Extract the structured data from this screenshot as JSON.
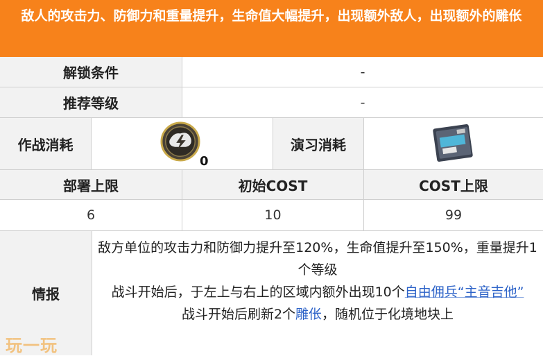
{
  "title": "敌人的攻击力、防御力和重量提升，生命值大幅提升，出现额外敌人，出现额外的雕伥",
  "rows": {
    "unlock": {
      "label": "解锁条件",
      "value": "-"
    },
    "recommended_level": {
      "label": "推荐等级",
      "value": "-"
    },
    "cost": {
      "battle_label": "作战消耗",
      "battle_value": "0",
      "battle_icon": "sanity-lightning-icon",
      "practice_label": "演习消耗",
      "practice_icon": "practice-ticket-icon"
    },
    "stats_headers": [
      "部署上限",
      "初始COST",
      "COST上限"
    ],
    "stats_values": [
      "6",
      "10",
      "99"
    ],
    "info": {
      "label": "情报",
      "line1": "敌方单位的攻击力和防御力提升至120%，生命值提升至150%，重量提升1个等级",
      "line2_prefix": "战斗开始后，于左上与右上的区域内额外出现10个",
      "line2_link": "自由佣兵“主音吉他”",
      "line3_prefix": "战斗开始后刷新2个",
      "line3_link": "雕伥",
      "line3_suffix": "，随机位于化境地块上"
    }
  },
  "watermark": "玩一玩",
  "colors": {
    "title_bg": "#f7821b",
    "header_bg": "#f2f2f2",
    "link": "#2d63c8"
  }
}
